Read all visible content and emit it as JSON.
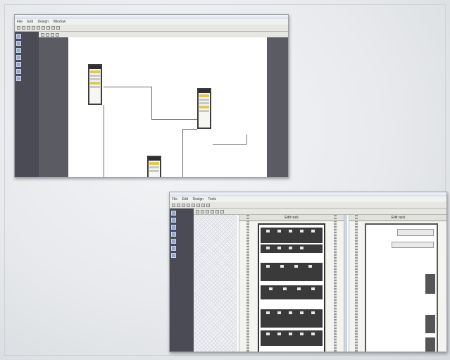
{
  "screenshot_1": {
    "menu": [
      "File",
      "Edit",
      "Design",
      "Window"
    ],
    "sidebar_items": [
      "",
      "",
      "",
      "",
      "",
      "",
      ""
    ]
  },
  "screenshot_2": {
    "menu": [
      "File",
      "Edit",
      "Design",
      "Tools"
    ],
    "panel_1_title": "Edit rack",
    "panel_2_title": "Edit rack",
    "sidebar_items": [
      "",
      "",
      "",
      "",
      "",
      "",
      ""
    ]
  },
  "colors": {
    "sidebar": "#4a4b54",
    "node_band": "#e4c653",
    "node_border": "#3b3b3b"
  }
}
